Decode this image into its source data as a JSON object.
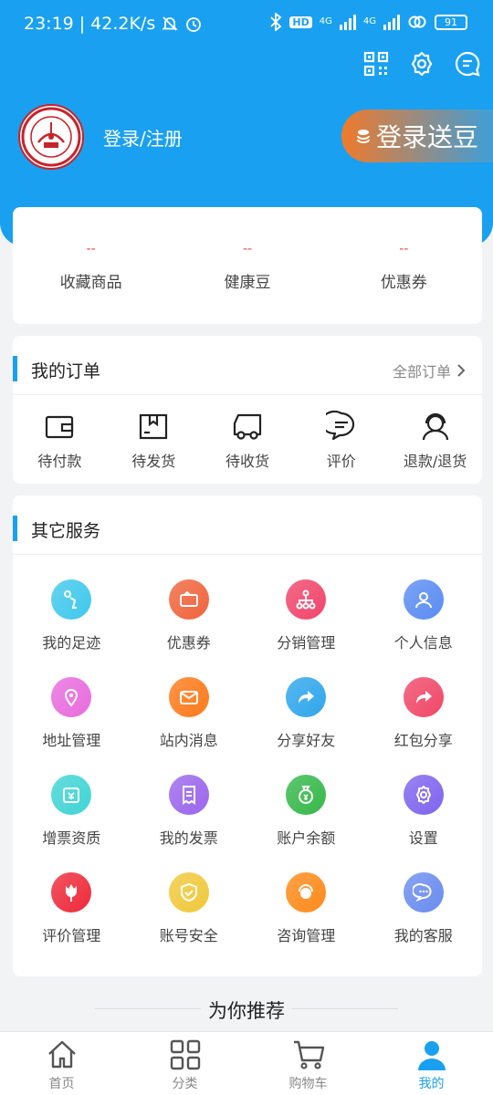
{
  "status": {
    "time": "23:19",
    "speed": "42.2K/s",
    "battery": "91",
    "hd": "HD",
    "lte1": "4G",
    "lte2": "4G"
  },
  "profile": {
    "login_register": "登录/注册",
    "login_bonus": "登录送豆"
  },
  "stats": [
    {
      "value": "--",
      "label": "收藏商品"
    },
    {
      "value": "--",
      "label": "健康豆"
    },
    {
      "value": "--",
      "label": "优惠券"
    }
  ],
  "orders": {
    "title": "我的订单",
    "all": "全部订单",
    "items": [
      "待付款",
      "待发货",
      "待收货",
      "评价",
      "退款/退货"
    ]
  },
  "services": {
    "title": "其它服务",
    "items": [
      {
        "label": "我的足迹",
        "icon": "footprint-icon",
        "color": "#3fc8ec"
      },
      {
        "label": "优惠券",
        "icon": "coupon-icon",
        "color": "#f0643c"
      },
      {
        "label": "分销管理",
        "icon": "distribution-icon",
        "color": "#f0456a"
      },
      {
        "label": "个人信息",
        "icon": "person-icon",
        "color": "#5a8cf2"
      },
      {
        "label": "地址管理",
        "icon": "location-icon",
        "color": "#e86bde"
      },
      {
        "label": "站内消息",
        "icon": "mail-icon",
        "color": "#ff7a1a"
      },
      {
        "label": "分享好友",
        "icon": "share-icon",
        "color": "#2fa6ec"
      },
      {
        "label": "红包分享",
        "icon": "share-redpacket-icon",
        "color": "#f04868"
      },
      {
        "label": "增票资质",
        "icon": "invoice-qualification-icon",
        "color": "#40d4d4"
      },
      {
        "label": "我的发票",
        "icon": "invoice-icon",
        "color": "#9a66ec"
      },
      {
        "label": "账户余额",
        "icon": "money-bag-icon",
        "color": "#36b84a"
      },
      {
        "label": "设置",
        "icon": "gear-icon",
        "color": "#7f64ee"
      },
      {
        "label": "评价管理",
        "icon": "flower-icon",
        "color": "#ee2a3a"
      },
      {
        "label": "账号安全",
        "icon": "shield-icon",
        "color": "#f0c83a"
      },
      {
        "label": "咨询管理",
        "icon": "consult-icon",
        "color": "#ff8a1a"
      },
      {
        "label": "我的客服",
        "icon": "chat-bubble-icon",
        "color": "#6a8cf0"
      }
    ]
  },
  "recommend": "为你推荐",
  "tabs": [
    {
      "label": "首页",
      "icon": "home-icon"
    },
    {
      "label": "分类",
      "icon": "category-icon"
    },
    {
      "label": "购物车",
      "icon": "cart-icon"
    },
    {
      "label": "我的",
      "icon": "user-icon"
    }
  ],
  "colors": {
    "primary": "#1aa0f0",
    "stat_value": "#e04b3c",
    "bonus_start": "#f07a2a",
    "bonus_end": "#3f9ed8"
  }
}
